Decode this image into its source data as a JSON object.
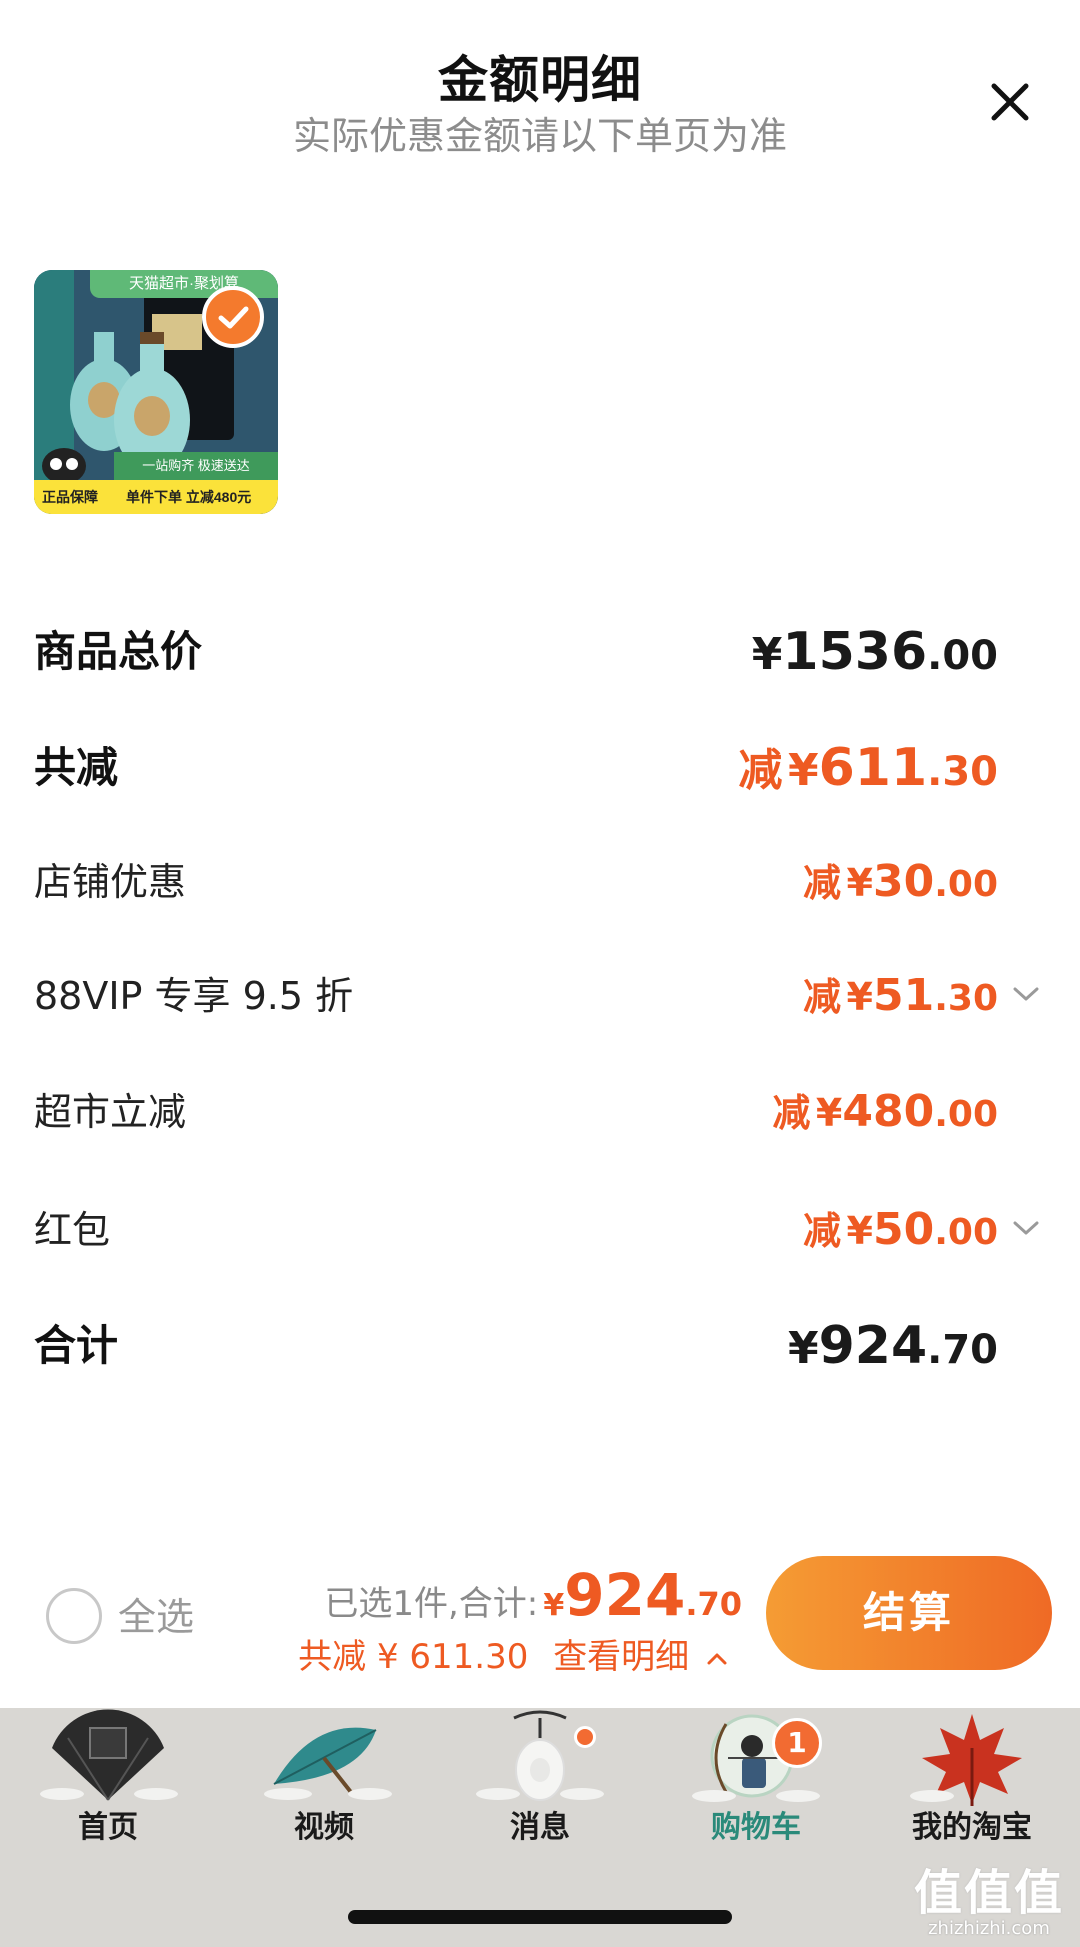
{
  "header": {
    "title": "金额明细",
    "subtitle": "实际优惠金额请以下单页为准"
  },
  "product": {
    "image_icon": "liquor-bottle-product-image",
    "top_tag": "天猫超市·聚划算",
    "band_text": "一站购齐 极速送达",
    "guarantee_badge": "正品保障",
    "promo_text": "单件下单 立减480元",
    "selected": true
  },
  "breakdown": [
    {
      "label": "商品总价",
      "prefix": "",
      "yen": "¥",
      "int": "1536",
      "dec": ".00",
      "style": "total",
      "has_chevron": false
    },
    {
      "label": "共减",
      "prefix": "减",
      "yen": "¥",
      "int": "611",
      "dec": ".30",
      "style": "discount-total",
      "has_chevron": false
    },
    {
      "label": "店铺优惠",
      "prefix": "减",
      "yen": "¥",
      "int": "30",
      "dec": ".00",
      "style": "discount",
      "has_chevron": false
    },
    {
      "label": "88VIP 专享 9.5 折",
      "prefix": "减",
      "yen": "¥",
      "int": "51",
      "dec": ".30",
      "style": "discount",
      "has_chevron": true
    },
    {
      "label": "超市立减",
      "prefix": "减",
      "yen": "¥",
      "int": "480",
      "dec": ".00",
      "style": "discount",
      "has_chevron": false
    },
    {
      "label": "红包",
      "prefix": "减",
      "yen": "¥",
      "int": "50",
      "dec": ".00",
      "style": "discount",
      "has_chevron": true
    },
    {
      "label": "合计",
      "prefix": "",
      "yen": "¥",
      "int": "924",
      "dec": ".70",
      "style": "total",
      "has_chevron": false
    }
  ],
  "checkout": {
    "select_all": "全选",
    "selected_count": "已选1件,合计:",
    "yen": "¥",
    "total_int": "924",
    "total_dec": ".70",
    "discount_text": "共减 ¥ 611.30",
    "detail_link": "查看明细",
    "button": "结算"
  },
  "tabs": [
    {
      "label": "首页",
      "icon": "fan-taobao-home-icon",
      "active": false
    },
    {
      "label": "视频",
      "icon": "umbrella-video-icon",
      "active": false
    },
    {
      "label": "消息",
      "icon": "jade-pendant-message-icon",
      "active": false,
      "dot": true
    },
    {
      "label": "购物车",
      "icon": "archer-cart-icon",
      "active": true,
      "badge": "1"
    },
    {
      "label": "我的淘宝",
      "icon": "maple-leaf-profile-icon",
      "active": false
    }
  ],
  "watermark": {
    "logo": "值值值",
    "url": "zhizhizhi.com"
  },
  "colors": {
    "accent_orange": "#ee5a22",
    "button_gradient_start": "#f59c34",
    "button_gradient_end": "#ef6a25",
    "tabbar_bg": "#d9d7d3",
    "active_tab": "#2a8a7a"
  }
}
